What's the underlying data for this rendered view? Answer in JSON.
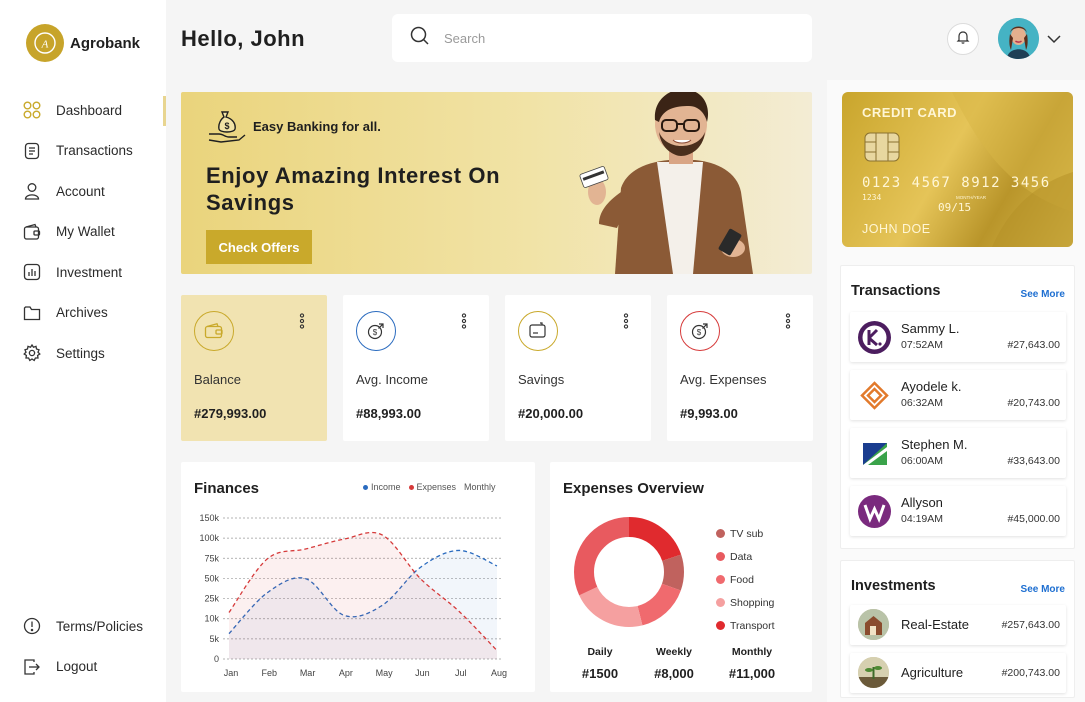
{
  "brand": {
    "name": "Agrobank",
    "logo_letter": "A"
  },
  "sidebar": {
    "items": [
      {
        "label": "Dashboard",
        "icon": "grid-icon",
        "active": true
      },
      {
        "label": "Transactions",
        "icon": "receipt-icon"
      },
      {
        "label": "Account",
        "icon": "user-icon"
      },
      {
        "label": "My Wallet",
        "icon": "wallet-icon"
      },
      {
        "label": "Investment",
        "icon": "chart-icon"
      },
      {
        "label": "Archives",
        "icon": "folder-icon"
      },
      {
        "label": "Settings",
        "icon": "gear-icon"
      }
    ],
    "bottom": [
      {
        "label": "Terms/Policies",
        "icon": "info-icon"
      },
      {
        "label": "Logout",
        "icon": "logout-icon"
      }
    ]
  },
  "header": {
    "greeting": "Hello, John",
    "search_placeholder": "Search"
  },
  "hero": {
    "tag": "Easy Banking for all.",
    "title": "Enjoy Amazing Interest On Savings",
    "button": "Check Offers"
  },
  "stats": [
    {
      "label": "Balance",
      "value": "#279,993.00",
      "icon": "wallet-icon",
      "color": "#c9a92b"
    },
    {
      "label": "Avg. Income",
      "value": "#88,993.00",
      "icon": "income-icon",
      "color": "#2a6bbf"
    },
    {
      "label": "Savings",
      "value": "#20,000.00",
      "icon": "savings-icon",
      "color": "#c9a92b"
    },
    {
      "label": "Avg. Expenses",
      "value": "#9,993.00",
      "icon": "expense-icon",
      "color": "#d63a3a"
    }
  ],
  "finances": {
    "title": "Finances",
    "legend": {
      "income": "Income",
      "expenses": "Expenses",
      "period": "Monthly"
    }
  },
  "chart_data": {
    "type": "line",
    "title": "Finances",
    "categories": [
      "Jan",
      "Feb",
      "Mar",
      "Apr",
      "May",
      "Jun",
      "Jul",
      "Aug"
    ],
    "y_ticks": [
      "150k",
      "100k",
      "75k",
      "50k",
      "25k",
      "10k",
      "5k",
      "0"
    ],
    "series": [
      {
        "name": "Income",
        "color": "#2a6bbf",
        "values": [
          18,
          47,
          57,
          31,
          38,
          65,
          77,
          66
        ]
      },
      {
        "name": "Expenses",
        "color": "#d63a3a",
        "values": [
          33,
          71,
          78,
          85,
          88,
          57,
          34,
          6
        ]
      }
    ]
  },
  "expenses": {
    "title": "Expenses Overview",
    "legend": [
      {
        "label": "TV sub",
        "color": "#c0625e"
      },
      {
        "label": "Data",
        "color": "#e85a5f"
      },
      {
        "label": "Food",
        "color": "#f06a6e"
      },
      {
        "label": "Shopping",
        "color": "#f5a0a0"
      },
      {
        "label": "Transport",
        "color": "#e02a2e"
      }
    ],
    "summary": [
      {
        "label": "Daily",
        "value": "#1500"
      },
      {
        "label": "Weekly",
        "value": "#8,000"
      },
      {
        "label": "Monthly",
        "value": "#11,000"
      }
    ]
  },
  "credit_card": {
    "title": "CREDIT CARD",
    "number": "0123 4567 8912 3456",
    "small": "1234",
    "valid_label": "MONTH/YEAR",
    "expiry": "09/15",
    "holder": "JOHN DOE"
  },
  "transactions": {
    "title": "Transactions",
    "see_more": "See More",
    "items": [
      {
        "name": "Sammy L.",
        "time": "07:52AM",
        "amount": "#27,643.00"
      },
      {
        "name": "Ayodele k.",
        "time": "06:32AM",
        "amount": "#20,743.00"
      },
      {
        "name": "Stephen M.",
        "time": "06:00AM",
        "amount": "#33,643.00"
      },
      {
        "name": "Allyson",
        "time": "04:19AM",
        "amount": "#45,000.00"
      }
    ]
  },
  "investments": {
    "title": "Investments",
    "see_more": "See More",
    "items": [
      {
        "name": "Real-Estate",
        "amount": "#257,643.00"
      },
      {
        "name": "Agriculture",
        "amount": "#200,743.00"
      }
    ]
  }
}
